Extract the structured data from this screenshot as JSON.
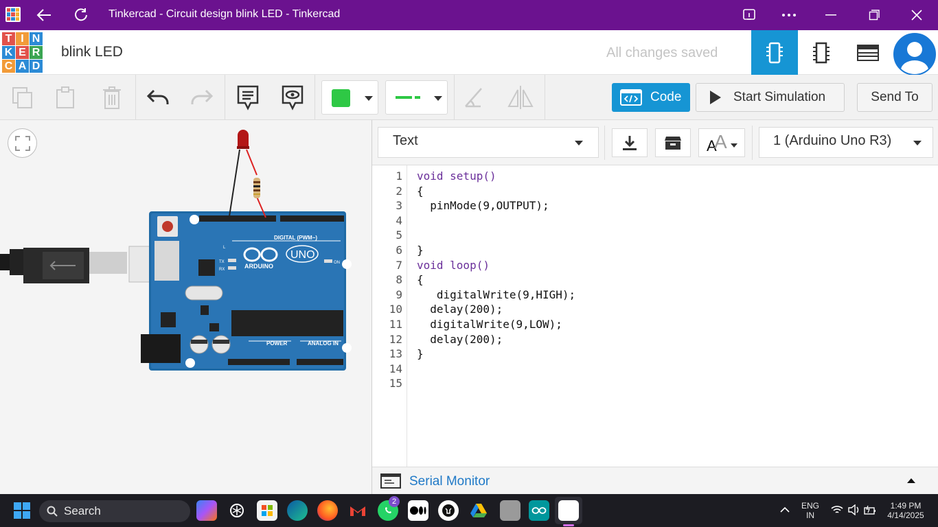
{
  "window": {
    "title": "Tinkercad - Circuit design blink LED - Tinkercad"
  },
  "header": {
    "logo_letters": [
      "T",
      "I",
      "N",
      "K",
      "E",
      "R",
      "C",
      "A",
      "D"
    ],
    "project_name": "blink LED",
    "save_status": "All changes saved"
  },
  "toolbar": {
    "code_label": "Code",
    "start_sim_label": "Start Simulation",
    "send_to_label": "Send To",
    "color_selected": "#2ec845"
  },
  "board": {
    "digital_label": "DIGITAL (PWM~)",
    "brand": "ARDUINO",
    "model": "UNO",
    "power_label": "POWER",
    "analog_label": "ANALOG IN",
    "on_label": "ON",
    "tx_label": "TX",
    "rx_label": "RX",
    "l_label": "L"
  },
  "code_editor": {
    "mode": "Text",
    "device": "1 (Arduino Uno R3)",
    "line_numbers": [
      "1",
      "2",
      "3",
      "4",
      "5",
      "6",
      "7",
      "8",
      "9",
      "10",
      "11",
      "12",
      "13",
      "14",
      "15"
    ],
    "lines": [
      "void setup()",
      "{",
      "  pinMode(9,OUTPUT);",
      "",
      "",
      "}",
      "void loop()",
      "{",
      "   digitalWrite(9,HIGH);",
      "  delay(200);",
      "  digitalWrite(9,LOW);",
      "  delay(200);",
      "}",
      "",
      ""
    ],
    "serial_monitor_label": "Serial Monitor"
  },
  "taskbar": {
    "search_label": "Search",
    "whatsapp_badge": "2",
    "lang_line1": "ENG",
    "lang_line2": "IN",
    "time": "1:49 PM",
    "date": "4/14/2025"
  }
}
